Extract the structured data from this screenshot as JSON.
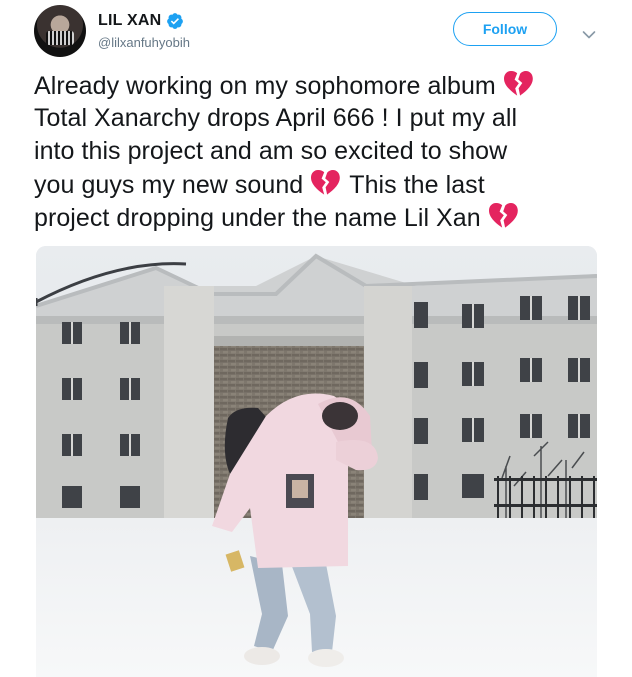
{
  "user": {
    "display_name": "LIL XAN",
    "handle": "@lilxanfuhyobih",
    "verified": true,
    "avatar_icon": "profile-avatar"
  },
  "actions": {
    "follow_label": "Follow",
    "more_icon": "chevron-down-icon"
  },
  "tweet": {
    "lines": [
      "Already working on my sophomore album",
      "Total Xanarchy drops April 666 ! I put my all",
      "into this project and am so excited to show",
      "you guys my new sound",
      "This the last",
      "project dropping under the name Lil Xan"
    ],
    "emoji": "broken-heart-icon"
  },
  "media": {
    "description_icon": "photo"
  },
  "colors": {
    "accent": "#1da1f2",
    "text": "#14171a",
    "secondary": "#657786",
    "heart": "#e4245f"
  }
}
